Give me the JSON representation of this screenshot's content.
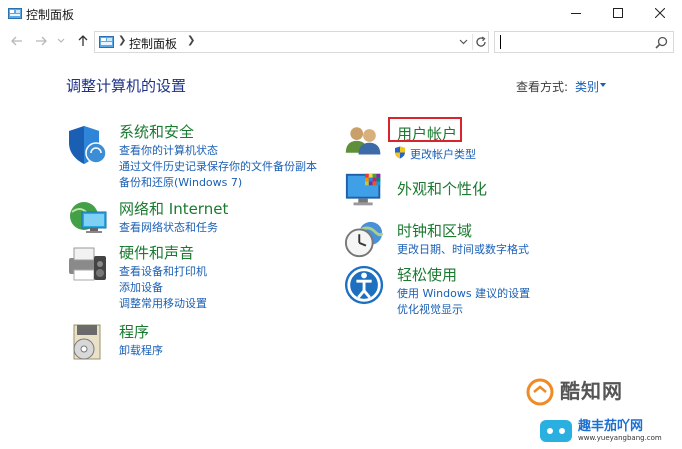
{
  "window": {
    "title": "控制面板"
  },
  "address": {
    "breadcrumb": "控制面板",
    "search_placeholder": ""
  },
  "main": {
    "heading": "调整计算机的设置",
    "view_by_label": "查看方式:",
    "view_by_value": "类别"
  },
  "categories": {
    "system": {
      "title": "系统和安全",
      "links": [
        "查看你的计算机状态",
        "通过文件历史记录保存你的文件备份副本",
        "备份和还原(Windows 7)"
      ]
    },
    "network": {
      "title": "网络和 Internet",
      "links": [
        "查看网络状态和任务"
      ]
    },
    "hardware": {
      "title": "硬件和声音",
      "links": [
        "查看设备和打印机",
        "添加设备",
        "调整常用移动设置"
      ]
    },
    "programs": {
      "title": "程序",
      "links": [
        "卸载程序"
      ]
    },
    "users": {
      "title": "用户帐户",
      "links": [
        "更改帐户类型"
      ]
    },
    "appearance": {
      "title": "外观和个性化",
      "links": []
    },
    "clock": {
      "title": "时钟和区域",
      "links": [
        "更改日期、时间或数字格式"
      ]
    },
    "ease": {
      "title": "轻松使用",
      "links": [
        "使用 Windows 建议的设置",
        "优化视觉显示"
      ]
    }
  },
  "watermark": {
    "brand": "酷知网",
    "site_name": "趣丰茄吖网",
    "site_url": "www.yueyangbang.com"
  },
  "colors": {
    "heading": "#1e3287",
    "category_title": "#1a7a30",
    "link": "#1a5fb4",
    "highlight_box": "#d9232d"
  },
  "icons": {
    "app": "control-panel-icon",
    "system": "shield-security-icon",
    "network": "network-globe-icon",
    "hardware": "printer-speaker-icon",
    "programs": "programs-disc-icon",
    "users": "user-accounts-icon",
    "appearance": "monitor-color-icon",
    "clock": "clock-globe-icon",
    "ease": "ease-of-access-icon"
  }
}
